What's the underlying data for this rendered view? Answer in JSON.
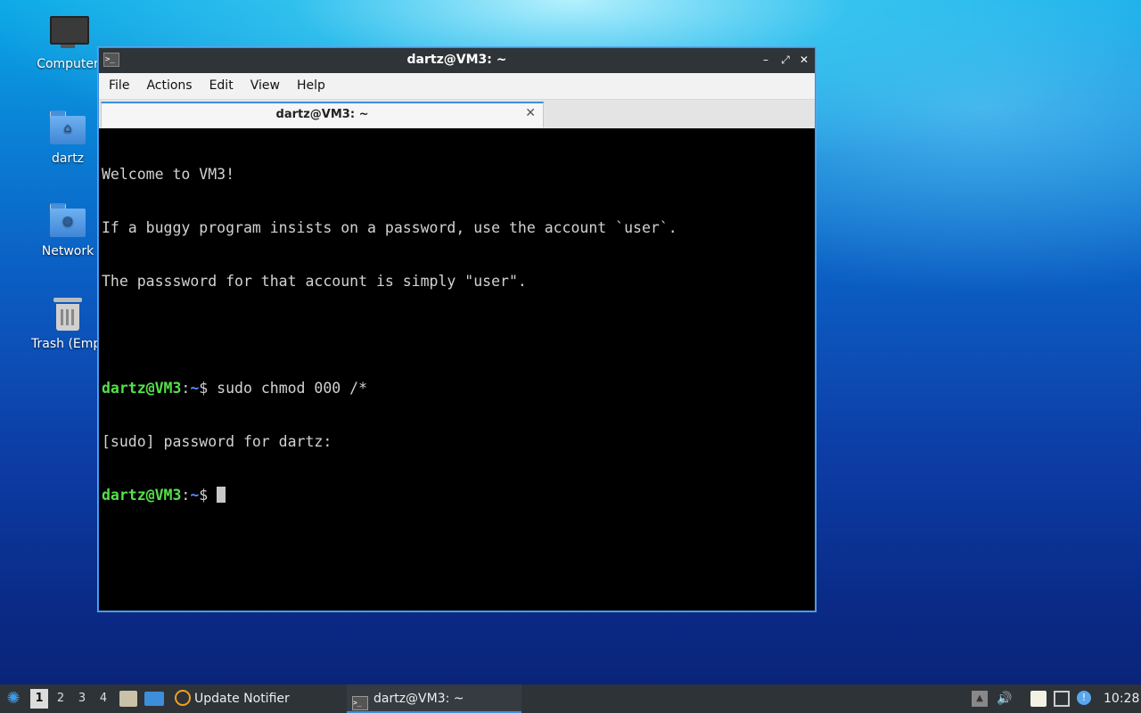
{
  "desktop": {
    "icons": [
      {
        "label": "Computer"
      },
      {
        "label": "dartz"
      },
      {
        "label": "Network"
      },
      {
        "label": "Trash (Empty)"
      }
    ]
  },
  "window": {
    "title": "dartz@VM3: ~",
    "controls": {
      "minimize": "–",
      "maximize": "⤢",
      "close": "✕"
    },
    "menu": [
      "File",
      "Actions",
      "Edit",
      "View",
      "Help"
    ],
    "tab": {
      "label": "dartz@VM3: ~",
      "close": "✕"
    },
    "terminal": {
      "welcome": [
        "Welcome to VM3!",
        "If a buggy program insists on a password, use the account `user`.",
        "The passsword for that account is simply \"user\"."
      ],
      "prompt_user": "dartz@VM3",
      "prompt_sep": ":",
      "prompt_path": "~",
      "prompt_end": "$ ",
      "command": "sudo chmod 000 /*",
      "sudo_prompt": "[sudo] password for dartz:"
    }
  },
  "taskbar": {
    "workspaces": [
      "1",
      "2",
      "3",
      "4"
    ],
    "active_workspace": "1",
    "tasks": [
      {
        "label": "Update Notifier",
        "icon": "update-notifier-icon"
      },
      {
        "label": "dartz@VM3: ~",
        "icon": "terminal-icon"
      }
    ],
    "clock": "10:28"
  }
}
